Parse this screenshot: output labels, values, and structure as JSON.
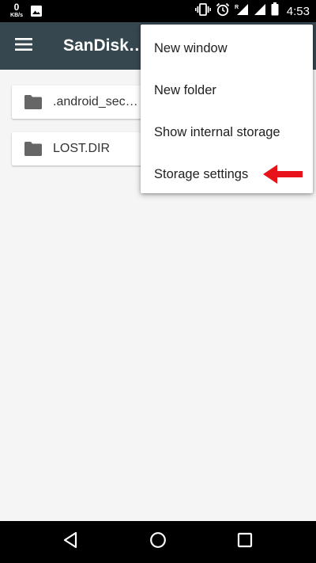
{
  "status_bar": {
    "speed_value": "0",
    "speed_unit": "KB/s",
    "time": "4:53",
    "icons": [
      "image-icon",
      "vibrate-icon",
      "alarm-icon",
      "signal-roaming-icon",
      "signal-icon",
      "battery-icon"
    ]
  },
  "toolbar": {
    "title": "SanDisk…",
    "menu_icon": "hamburger-menu-icon"
  },
  "folders": [
    {
      "name": ".android_sec…",
      "icon": "folder-icon"
    },
    {
      "name": "LOST.DIR",
      "icon": "folder-icon"
    }
  ],
  "overflow_menu": {
    "items": [
      {
        "label": "New window"
      },
      {
        "label": "New folder"
      },
      {
        "label": "Show internal storage"
      },
      {
        "label": "Storage settings"
      }
    ]
  },
  "annotation": {
    "arrow_color": "#e8121b",
    "points_to": "Storage settings"
  },
  "nav_bar": {
    "icons": [
      "back-icon",
      "home-icon",
      "recents-icon"
    ]
  },
  "colors": {
    "toolbar": "#37474f",
    "background": "#f5f5f5",
    "folder_icon": "#666666"
  }
}
